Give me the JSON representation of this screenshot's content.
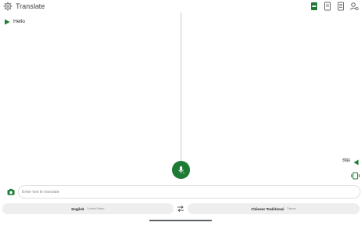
{
  "app": {
    "title": "Translate"
  },
  "toolbar": {
    "icons": [
      "gear-icon",
      "phrasebook-icon",
      "history-icon",
      "notes-icon",
      "profile-icon"
    ]
  },
  "source": {
    "text": "Hello"
  },
  "target": {
    "text": "你好"
  },
  "input": {
    "placeholder": "Enter text to translate",
    "value": ""
  },
  "languages": {
    "source_name": "English",
    "source_sub": "United States",
    "target_name": "Chinese Traditional",
    "target_sub": "Taiwan"
  },
  "colors": {
    "accent": "#1e7b34",
    "divider": "#c8c8c8",
    "pill_bg": "#eeeeee"
  }
}
